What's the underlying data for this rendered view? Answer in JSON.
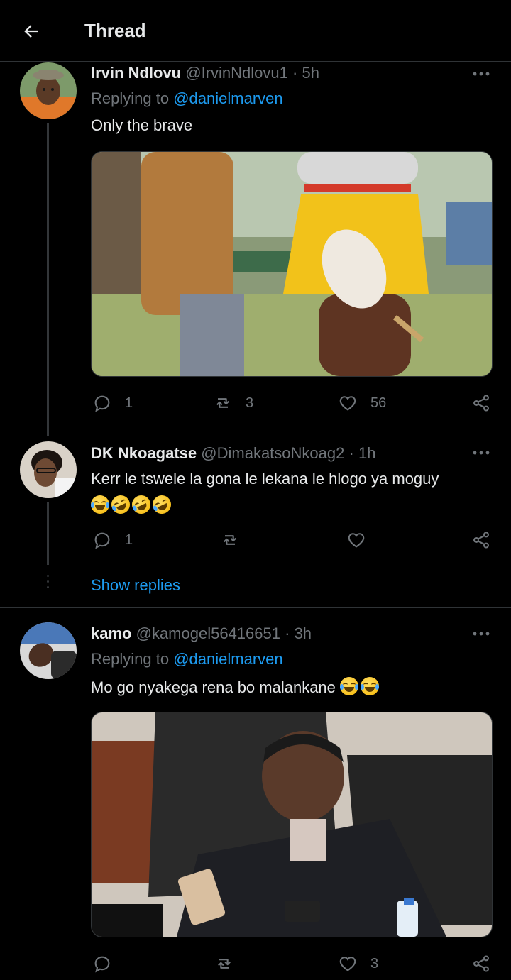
{
  "header": {
    "title": "Thread",
    "back_icon": "arrow-left-icon"
  },
  "tweets": [
    {
      "name": "Irvin Ndlovu",
      "handle": "@IrvinNdlovu1",
      "separator": "·",
      "time": "5h",
      "replying_prefix": "Replying to",
      "replying_to": "@danielmarven",
      "text": "Only the brave",
      "actions": {
        "replies": "1",
        "retweets": "3",
        "likes": "56"
      }
    },
    {
      "name": "DK Nkoagatse",
      "handle": "@DimakatsoNkoag2",
      "separator": "·",
      "time": "1h",
      "text": "Kerr le tswele la gona le lekana le hlogo ya moguy",
      "actions": {
        "replies": "1",
        "retweets": "",
        "likes": ""
      }
    },
    {
      "name": "kamo",
      "handle": "@kamogel56416651",
      "separator": "·",
      "time": "3h",
      "replying_prefix": "Replying to",
      "replying_to": "@danielmarven",
      "text": "Mo go nyakega rena bo malankane",
      "actions": {
        "replies": "",
        "retweets": "",
        "likes": "3"
      }
    }
  ],
  "show_replies": "Show replies",
  "colors": {
    "background": "#000000",
    "text": "#e7e9ea",
    "secondary": "#71767b",
    "accent": "#1d9bf0",
    "border": "#2f3336"
  }
}
